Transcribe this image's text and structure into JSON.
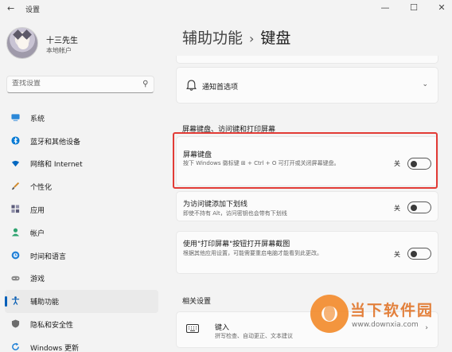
{
  "window": {
    "app_name": "设置",
    "back": "←",
    "minimize": "—",
    "maximize": "☐",
    "close": "✕"
  },
  "user": {
    "name": "十三先生",
    "account_type": "本地帐户"
  },
  "search": {
    "placeholder": "查找设置"
  },
  "nav": {
    "items": [
      {
        "label": "系统",
        "icon": "system-icon",
        "color": "#0078d4"
      },
      {
        "label": "蓝牙和其他设备",
        "icon": "bluetooth-icon",
        "color": "#0078d4"
      },
      {
        "label": "网络和 Internet",
        "icon": "wifi-icon",
        "color": "#0067c0"
      },
      {
        "label": "个性化",
        "icon": "brush-icon",
        "color": "#d08a2c"
      },
      {
        "label": "应用",
        "icon": "apps-icon",
        "color": "#5c5c7a"
      },
      {
        "label": "帐户",
        "icon": "account-icon",
        "color": "#2ea36f"
      },
      {
        "label": "时间和语言",
        "icon": "globe-time-icon",
        "color": "#1f7fd6"
      },
      {
        "label": "游戏",
        "icon": "gamepad-icon",
        "color": "#8a8a8a"
      },
      {
        "label": "辅助功能",
        "icon": "accessibility-icon",
        "color": "#0a5fb4"
      },
      {
        "label": "隐私和安全性",
        "icon": "shield-icon",
        "color": "#6d6d6d"
      },
      {
        "label": "Windows 更新",
        "icon": "update-icon",
        "color": "#1c7fd6"
      }
    ],
    "active_index": 8
  },
  "header": {
    "parent": "辅助功能",
    "separator": "›",
    "current": "键盘"
  },
  "notifications_card": {
    "title": "通知首选项"
  },
  "section1": {
    "label": "屏幕键盘、访问键和打印屏幕"
  },
  "osk_card": {
    "title": "屏幕键盘",
    "desc": "按下 Windows 徽标键 ⊞ + Ctrl + O 可打开或关闭屏幕键盘。",
    "state_label": "关",
    "on": false
  },
  "underline_card": {
    "title": "为访问键添加下划线",
    "desc": "即使不持有 Alt，访问密钥也会带有下划线",
    "state_label": "关",
    "on": false
  },
  "printscreen_card": {
    "title": "使用\"打印屏幕\"按钮打开屏幕截图",
    "desc": "根据其他应用设置，可能需要重启电脑才能看到此更改。",
    "state_label": "关",
    "on": false
  },
  "section2": {
    "label": "相关设置"
  },
  "typing_card": {
    "title": "键入",
    "desc": "拼写检查、自动更正、文本建议"
  },
  "watermark": {
    "text": "当下软件园",
    "url": "www.downxia.com"
  },
  "colors": {
    "accent": "#005fb8",
    "highlight": "#e23b36",
    "background": "#f3f3f3",
    "card": "#fbfbfb"
  }
}
